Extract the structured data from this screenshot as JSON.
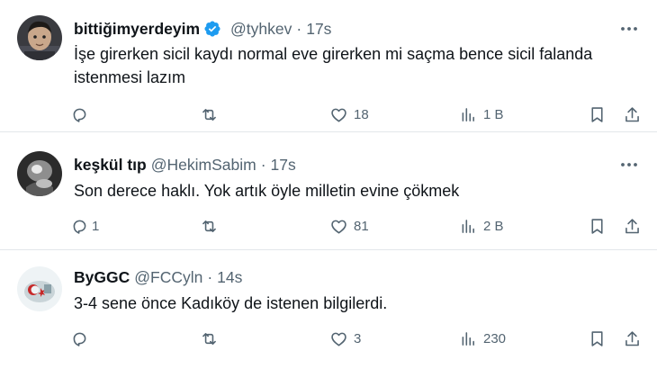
{
  "tweets": [
    {
      "name": "bittiğimyerdeyim",
      "verified": true,
      "handle": "@tyhkev",
      "dot": "·",
      "time": "17s",
      "text_line1": "İşe girerken sicil kaydı normal eve girerken mi saçma bence sicil falanda",
      "text_line2": "istenmesi lazım",
      "replies": "",
      "retweets": "",
      "likes": "18",
      "views": "1 B"
    },
    {
      "name": "keşkül tıp",
      "verified": false,
      "handle": "@HekimSabim",
      "dot": "·",
      "time": "17s",
      "text_line1": "Son derece haklı. Yok artık öyle milletin evine çökmek",
      "replies": "1",
      "retweets": "",
      "likes": "81",
      "views": "2 B"
    },
    {
      "name": "ByGGC",
      "verified": false,
      "handle": "@FCCyln",
      "dot": "·",
      "time": "14s",
      "text_line1": "3-4 sene önce Kadıköy de istenen bilgilerdi.",
      "replies": "",
      "retweets": "",
      "likes": "3",
      "views": "230"
    }
  ],
  "colors": {
    "text": "#0f1419",
    "secondary": "#536471",
    "verified_blue": "#1d9bf0",
    "separator": "#e3e7ea"
  },
  "icons": {
    "reply": "reply-icon",
    "retweet": "retweet-icon",
    "like": "heart-icon",
    "views": "views-icon",
    "bookmark": "bookmark-icon",
    "share": "share-icon",
    "more": "more-icon",
    "verified": "verified-badge-icon"
  }
}
